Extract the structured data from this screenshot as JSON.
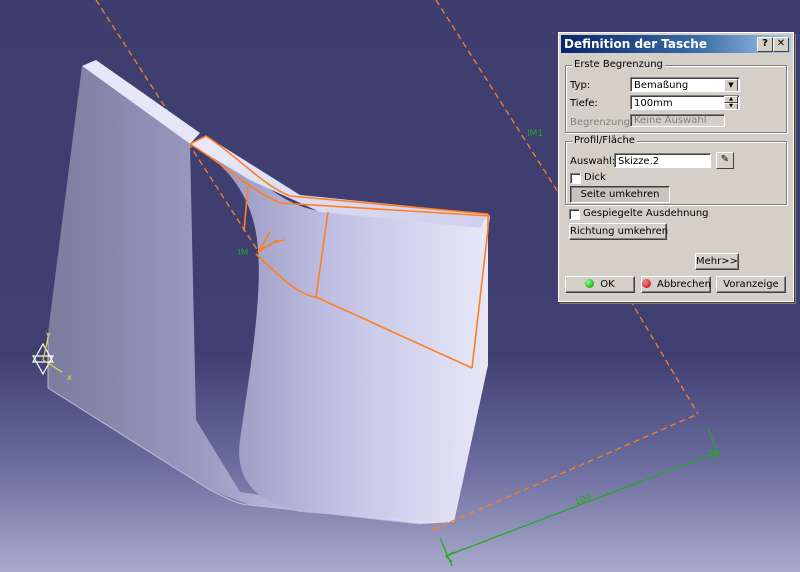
{
  "viewport": {
    "background_top": "#3d3d6e",
    "background_bottom": "#a9aacb",
    "highlight_color": "#ff7f1f",
    "dimension_color": "#22aa22",
    "plane_label": "IM1",
    "point_label": "IM",
    "dimension_value": "100",
    "axis_labels": {
      "x": "x",
      "y": "y"
    }
  },
  "dialog": {
    "title": "Definition der Tasche",
    "help_label": "?",
    "close_label": "✕",
    "first_limit": {
      "legend": "Erste Begrenzung",
      "type_label": "Typ:",
      "type_value": "Bemaßung",
      "depth_label": "Tiefe:",
      "depth_value": "100mm",
      "limit_label": "Begrenzung:",
      "limit_value": "Keine Auswahl"
    },
    "profile": {
      "legend": "Profil/Fläche",
      "selection_label": "Auswahl:",
      "selection_value": "Skizze.2",
      "thick_label": "Dick",
      "thick_checked": false,
      "reverse_side_label": "Seite umkehren"
    },
    "mirrored_label": "Gespiegelte Ausdehnung",
    "mirrored_checked": false,
    "reverse_direction_label": "Richtung umkehren",
    "more_label": "Mehr>>",
    "ok_label": "OK",
    "cancel_label": "Abbrechen",
    "preview_label": "Voranzeige"
  }
}
